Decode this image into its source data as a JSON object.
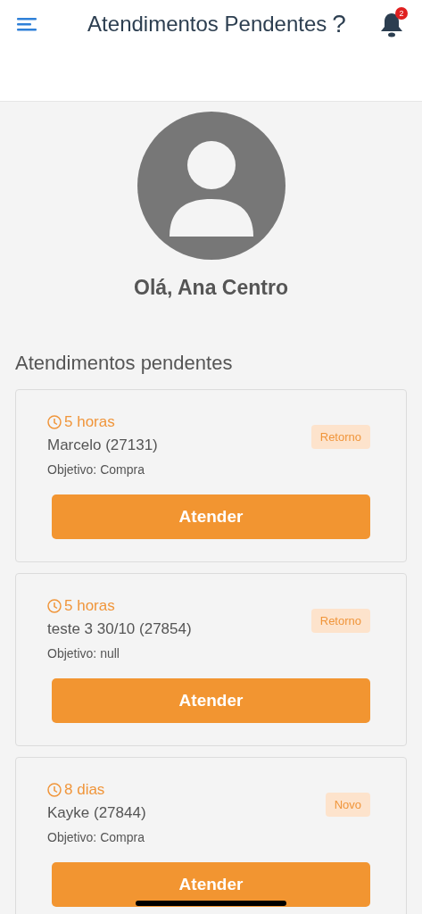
{
  "header": {
    "title": "Atendimentos Pendentes",
    "help": "?",
    "notifications": "2"
  },
  "greeting": "Olá, Ana Centro",
  "section_title": "Atendimentos pendentes",
  "cards": [
    {
      "time": "5 horas",
      "name": "Marcelo (27131)",
      "objective": "Objetivo: Compra",
      "badge": "Retorno",
      "button": "Atender"
    },
    {
      "time": "5 horas",
      "name": "teste 3 30/10 (27854)",
      "objective": "Objetivo: null",
      "badge": "Retorno",
      "button": "Atender"
    },
    {
      "time": "8 dias",
      "name": "Kayke (27844)",
      "objective": "Objetivo: Compra",
      "badge": "Novo",
      "button": "Atender"
    }
  ]
}
